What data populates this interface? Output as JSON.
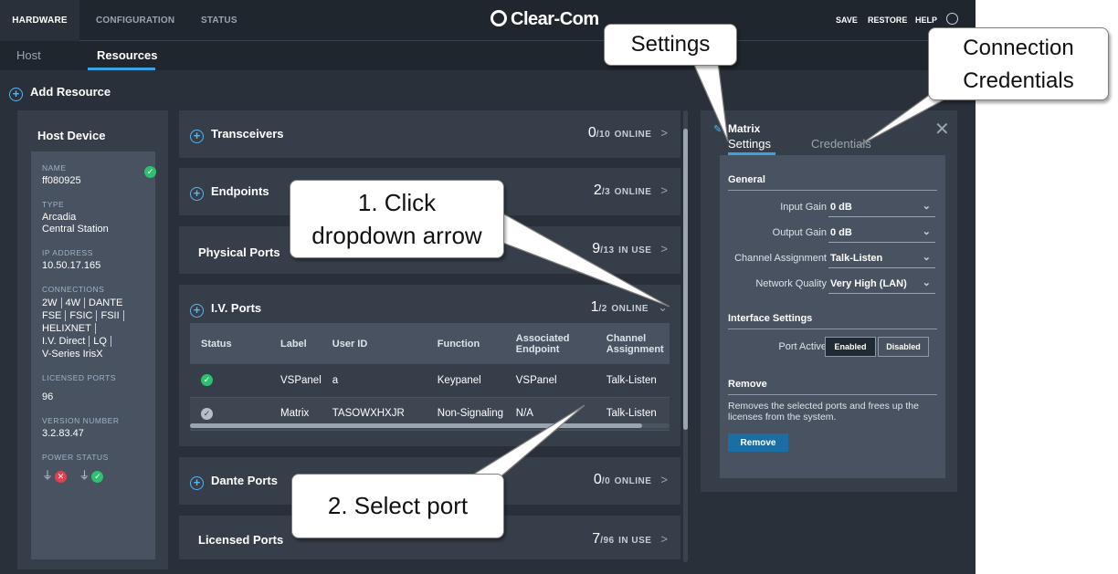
{
  "nav": {
    "tabs": [
      "HARDWARE",
      "CONFIGURATION",
      "STATUS"
    ],
    "logo": "Clear-Com",
    "actions": {
      "save": "SAVE",
      "restore": "RESTORE",
      "help": "HELP"
    }
  },
  "subnav": {
    "host": "Host",
    "resources": "Resources"
  },
  "add_resource": "Add Resource",
  "host": {
    "title": "Host Device",
    "name_label": "NAME",
    "name": "ff080925",
    "type_label": "TYPE",
    "type_line1": "Arcadia",
    "type_line2": "Central Station",
    "ip_label": "IP ADDRESS",
    "ip": "10.50.17.165",
    "connections_label": "CONNECTIONS",
    "connections": [
      "2W",
      "4W",
      "DANTE",
      "FSE",
      "FSIC",
      "FSII",
      "HELIXNET",
      "I.V. Direct",
      "LQ",
      "V-Series IrisX"
    ],
    "licensed_label": "LICENSED PORTS",
    "licensed": "96",
    "version_label": "VERSION NUMBER",
    "version": "3.2.83.47",
    "power_label": "POWER STATUS"
  },
  "sections": {
    "transceivers": {
      "title": "Transceivers",
      "count": "0",
      "total": "/10",
      "status": "ONLINE"
    },
    "endpoints": {
      "title": "Endpoints",
      "count": "2",
      "total": "/3",
      "status": "ONLINE"
    },
    "physical": {
      "title": "Physical Ports",
      "count": "9",
      "total": "/13",
      "status": "IN USE"
    },
    "iv": {
      "title": "I.V. Ports",
      "count": "1",
      "total": "/2",
      "status": "ONLINE"
    },
    "dante": {
      "title": "Dante Ports",
      "count": "0",
      "total": "/0",
      "status": "ONLINE"
    },
    "licensed": {
      "title": "Licensed Ports",
      "count": "7",
      "total": "/96",
      "status": "IN USE"
    }
  },
  "iv_table": {
    "headers": [
      "Status",
      "Label",
      "User ID",
      "Function",
      "Associated Endpoint",
      "Channel Assignment"
    ],
    "rows": [
      {
        "label": "VSPanel",
        "user_id": "a",
        "function": "Keypanel",
        "endpoint": "VSPanel",
        "channel": "Talk-Listen"
      },
      {
        "label": "Matrix",
        "user_id": "TASOWXHXJR",
        "function": "Non-Signaling",
        "endpoint": "N/A",
        "channel": "Talk-Listen"
      }
    ]
  },
  "panel": {
    "title": "Matrix",
    "tab_settings": "Settings",
    "tab_credentials": "Credentials",
    "general": "General",
    "input_gain_label": "Input Gain",
    "input_gain": "0 dB",
    "output_gain_label": "Output Gain",
    "output_gain": "0 dB",
    "channel_label": "Channel Assignment",
    "channel": "Talk-Listen",
    "network_label": "Network Quality",
    "network": "Very High (LAN)",
    "interface": "Interface Settings",
    "port_active_label": "Port Active",
    "enabled": "Enabled",
    "disabled": "Disabled",
    "remove_heading": "Remove",
    "remove_desc": "Removes the selected ports and frees up the licenses from the system.",
    "remove_button": "Remove"
  },
  "callouts": {
    "settings": "Settings",
    "credentials_line1": "Connection",
    "credentials_line2": "Credentials",
    "step1_line1": "1. Click",
    "step1_line2": "dropdown arrow",
    "step2": "2. Select port"
  },
  "colors": {
    "accent": "#3aa3e3",
    "online": "#2fbf71",
    "offline": "#e0414f",
    "background": "#29303a",
    "card": "#363e49"
  }
}
